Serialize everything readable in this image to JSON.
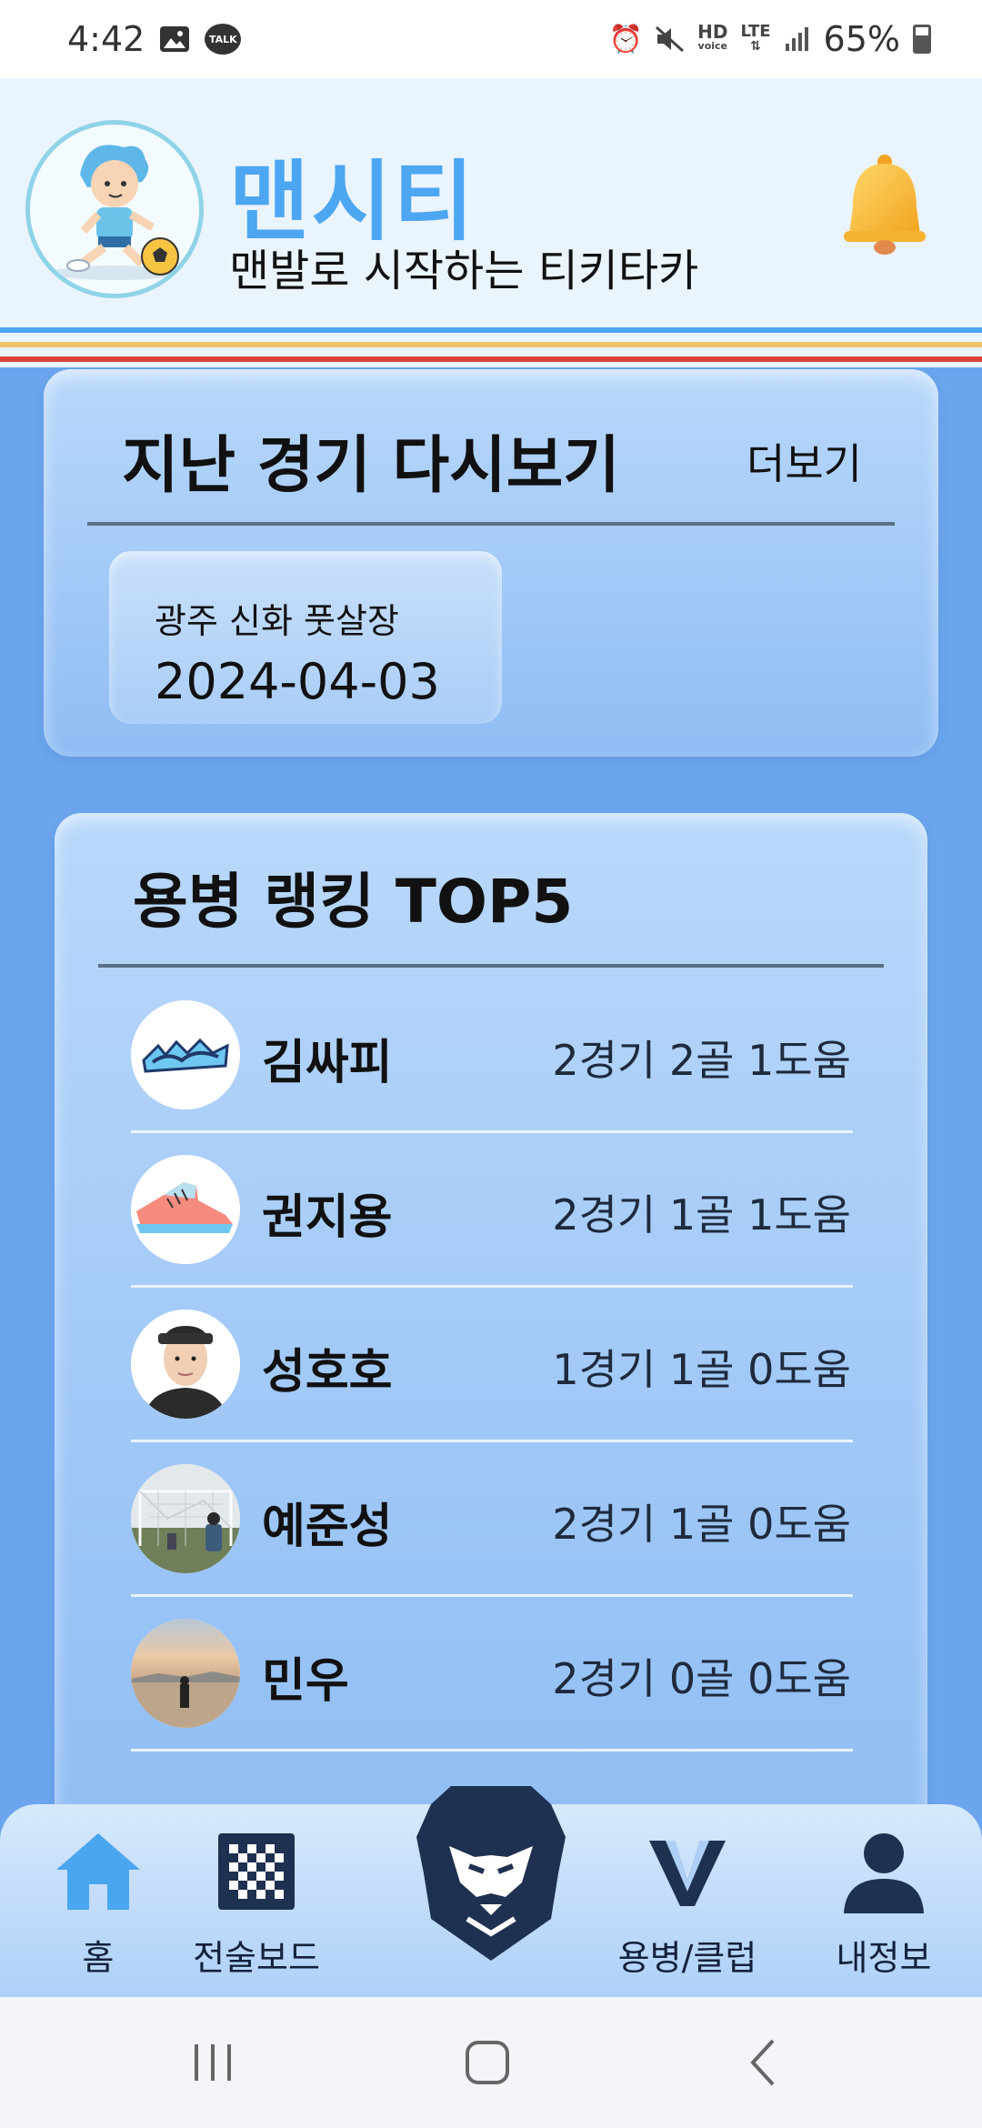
{
  "status_bar": {
    "time": "4:42",
    "left_icons": [
      "image-icon",
      "talk-icon"
    ],
    "talk_badge": "TALK",
    "hd_text": "HD",
    "voice_text": "voice",
    "lte_text": "LTE",
    "battery": "65%"
  },
  "header": {
    "title": "맨시티",
    "subtitle": "맨발로 시작하는 티키타카",
    "stripe_colors": [
      "#4da6f2",
      "#f1c46a",
      "#d9443a"
    ]
  },
  "recent": {
    "title": "지난 경기 다시보기",
    "more": "더보기",
    "match": {
      "place": "광주 신화 풋살장",
      "date": "2024-04-03"
    }
  },
  "ranking": {
    "title": "용병 랭킹 TOP5",
    "players": [
      {
        "name": "김싸피",
        "stat": "2경기 2골 1도움",
        "avatar": "ssafy-logo"
      },
      {
        "name": "권지용",
        "stat": "2경기 1골 1도움",
        "avatar": "sneaker-icon"
      },
      {
        "name": "성호호",
        "stat": "1경기 1골 0도움",
        "avatar": "portrait"
      },
      {
        "name": "예준성",
        "stat": "2경기 1골 0도움",
        "avatar": "goal-photo"
      },
      {
        "name": "민우",
        "stat": "2경기 0골 0도움",
        "avatar": "sunset-photo"
      }
    ]
  },
  "bottom_nav": {
    "items": [
      {
        "label": "홈",
        "icon": "home-icon"
      },
      {
        "label": "전술보드",
        "icon": "checkerboard-icon"
      },
      {
        "label": "용병/클럽",
        "icon": "v-icon"
      },
      {
        "label": "내정보",
        "icon": "user-icon"
      }
    ],
    "center_icon": "lion-icon"
  },
  "colors": {
    "accent": "#4da6f2",
    "background": "#6aa5ee",
    "nav_icon": "#1f3150"
  }
}
